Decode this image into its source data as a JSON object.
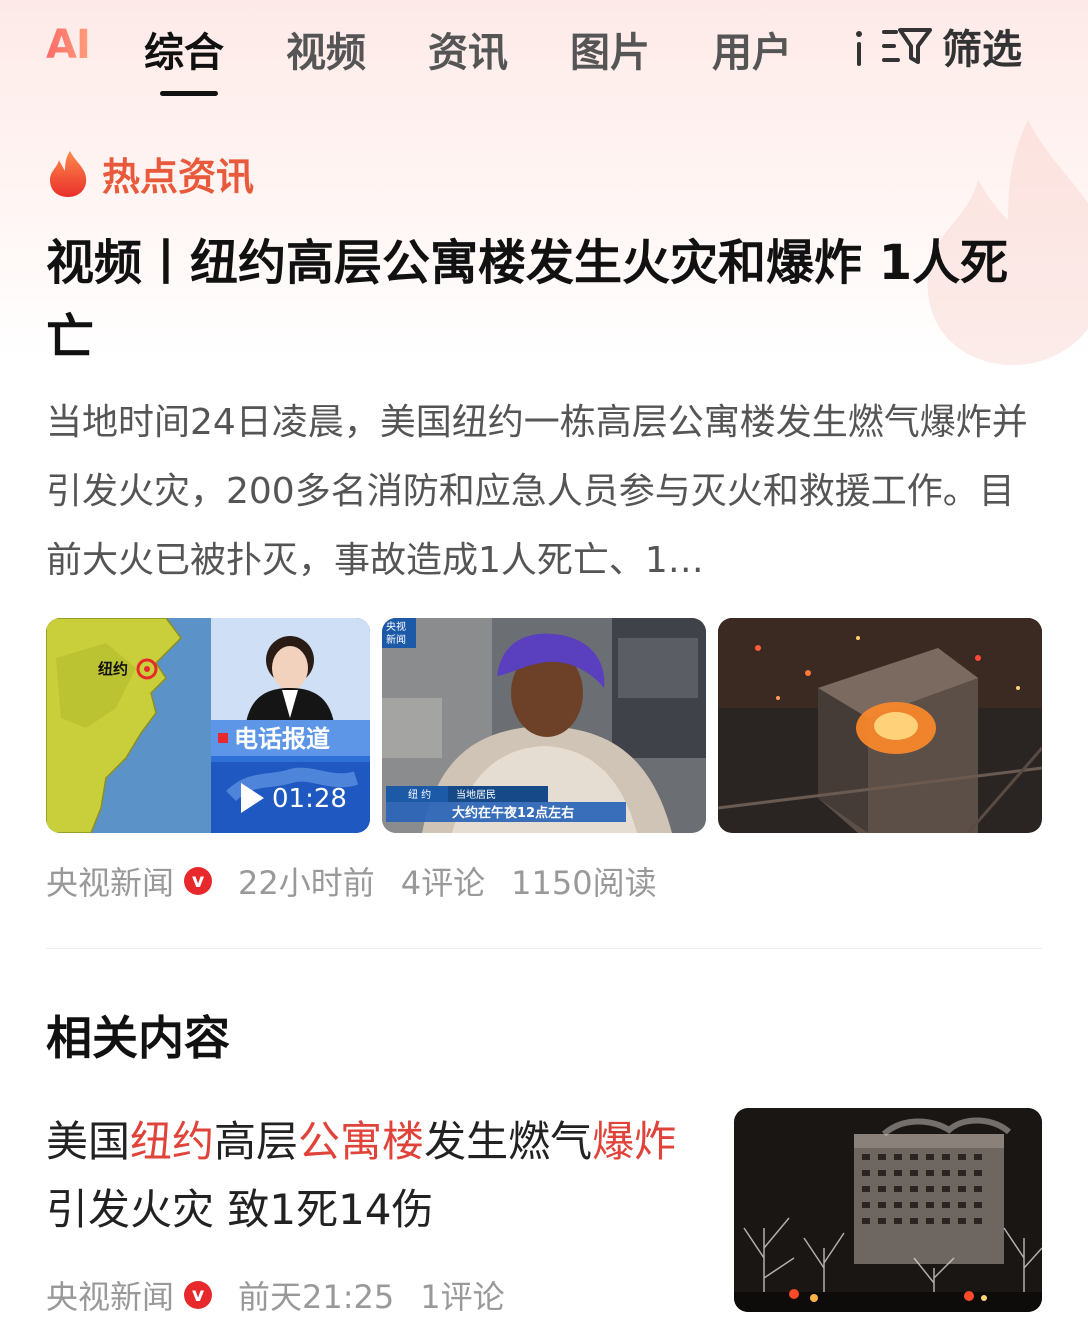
{
  "tabs": {
    "ai_logo": "AI",
    "items": [
      "综合",
      "视频",
      "资讯",
      "图片",
      "用户"
    ],
    "active_index": 0,
    "filter_label": "筛选"
  },
  "hot_section": {
    "label": "热点资讯",
    "headline": "视频丨纽约高层公寓楼发生火灾和爆炸 1人死亡",
    "summary": "当地时间24日凌晨，美国纽约一栋高层公寓楼发生燃气爆炸并引发火灾，200多名消防和应急人员参与灭火和救援工作。目前大火已被扑灭，事故造成1人死亡、1…",
    "thumbnails": {
      "map_city_label": "纽约",
      "news_banner": "电话报道",
      "video_duration": "01:28",
      "cctv_logo_line1": "央视",
      "cctv_logo_line2": "新闻",
      "caption_location": "纽  约",
      "caption_speaker": "当地居民",
      "caption_text": "大约在午夜12点左右"
    },
    "meta": {
      "source": "央视新闻",
      "badge": "v",
      "time": "22小时前",
      "comments": "4评论",
      "reads": "1150阅读"
    }
  },
  "related": {
    "title": "相关内容",
    "headline_parts": [
      {
        "text": "美国",
        "highlight": false
      },
      {
        "text": "纽约",
        "highlight": true
      },
      {
        "text": "高层",
        "highlight": false
      },
      {
        "text": "公寓楼",
        "highlight": true
      },
      {
        "text": "发生燃气",
        "highlight": false
      },
      {
        "text": "爆炸",
        "highlight": true
      },
      {
        "text": "引发火灾 致1死14伤",
        "highlight": false
      }
    ],
    "meta": {
      "source": "央视新闻",
      "badge": "v",
      "time": "前天21:25",
      "comments": "1评论"
    }
  },
  "colors": {
    "accent_red": "#e0433a",
    "hot_orange": "#e85a3b",
    "badge_red": "#e8292c"
  }
}
